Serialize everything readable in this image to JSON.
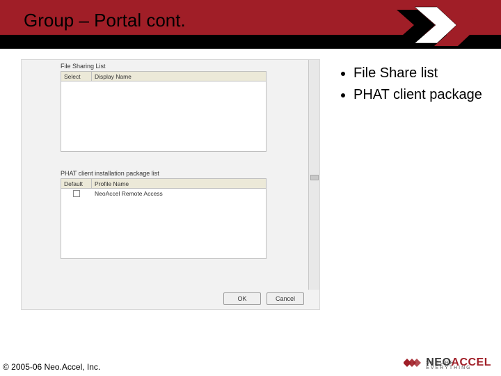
{
  "title": "Group – Portal cont.",
  "bullets": [
    "File Share list",
    "PHAT client package"
  ],
  "screenshot": {
    "section1_label": "File Sharing List",
    "section2_label": "PHAT client installation package list",
    "table1": {
      "headers": [
        "Select",
        "Display Name"
      ]
    },
    "table2": {
      "headers": [
        "Default",
        "Profile Name"
      ],
      "row1_name": "NeoAccel Remote Access"
    },
    "buttons": {
      "ok": "OK",
      "cancel": "Cancel"
    }
  },
  "copyright": "© 2005-06 Neo.Accel, Inc.",
  "logo": {
    "brand_a": "NEO",
    "brand_b": "ACCEL",
    "tagline": "SECURE EVERYTHING"
  }
}
